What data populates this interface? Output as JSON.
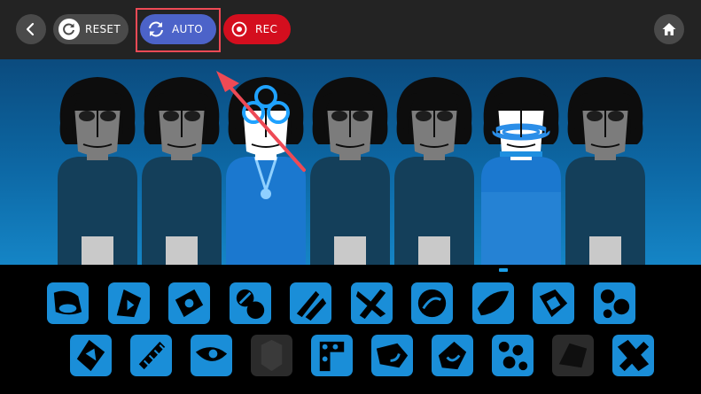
{
  "topbar": {
    "back_icon": "chevron-left-icon",
    "reset_label": "RESET",
    "reset_icon": "rotate-icon",
    "auto_label": "AUTO",
    "auto_icon": "refresh-icon",
    "rec_label": "REC",
    "rec_icon": "record-icon",
    "home_icon": "home-icon"
  },
  "colors": {
    "topbar_bg": "#232323",
    "button_gray": "#4a4a4a",
    "auto_blue": "#4c63c9",
    "rec_red": "#d40e1e",
    "highlight": "#ee4a55",
    "sound_blue": "#1a8ed8"
  },
  "stage": {
    "performers": [
      {
        "state": "idle"
      },
      {
        "state": "idle"
      },
      {
        "state": "active"
      },
      {
        "state": "idle"
      },
      {
        "state": "idle"
      },
      {
        "state": "active"
      },
      {
        "state": "idle"
      }
    ]
  },
  "sounds": {
    "row1": [
      {
        "icon": "sound-icon-1",
        "used": false
      },
      {
        "icon": "sound-icon-2",
        "used": false
      },
      {
        "icon": "sound-icon-3",
        "used": false
      },
      {
        "icon": "sound-icon-4",
        "used": false
      },
      {
        "icon": "sound-icon-5",
        "used": false
      },
      {
        "icon": "sound-icon-6",
        "used": false
      },
      {
        "icon": "sound-icon-7",
        "used": false
      },
      {
        "icon": "sound-icon-8",
        "used": false
      },
      {
        "icon": "sound-icon-9",
        "used": false
      },
      {
        "icon": "sound-icon-10",
        "used": false
      }
    ],
    "row2": [
      {
        "icon": "sound-icon-11",
        "used": false
      },
      {
        "icon": "sound-icon-12",
        "used": false
      },
      {
        "icon": "sound-icon-13",
        "used": false
      },
      {
        "icon": "sound-icon-14",
        "used": true
      },
      {
        "icon": "sound-icon-15",
        "used": false
      },
      {
        "icon": "sound-icon-16",
        "used": false
      },
      {
        "icon": "sound-icon-17",
        "used": false
      },
      {
        "icon": "sound-icon-18",
        "used": false
      },
      {
        "icon": "sound-icon-19",
        "used": true
      },
      {
        "icon": "sound-icon-20",
        "used": false
      }
    ]
  }
}
